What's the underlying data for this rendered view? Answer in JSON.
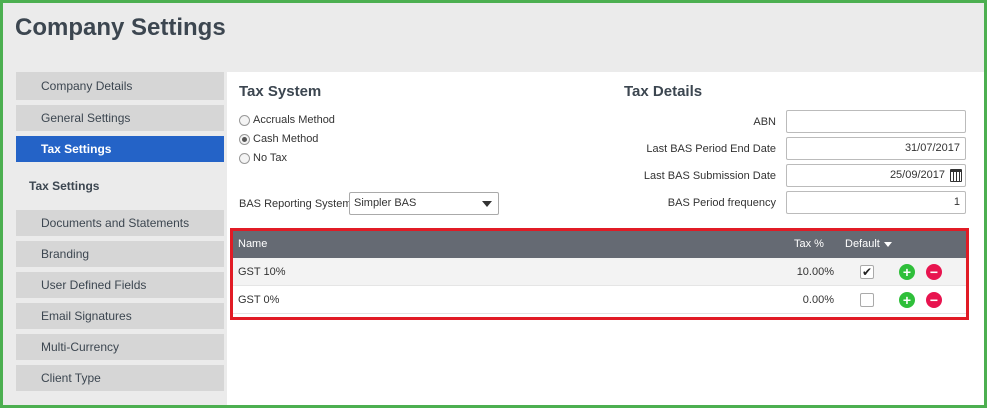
{
  "page_title": "Company Settings",
  "sidebar": {
    "items_top": [
      {
        "label": "Company Details"
      },
      {
        "label": "General Settings"
      },
      {
        "label": "Tax Settings",
        "active": true
      }
    ],
    "section_header": "Tax Settings",
    "items_bottom": [
      {
        "label": "Documents and Statements"
      },
      {
        "label": "Branding"
      },
      {
        "label": "User Defined Fields"
      },
      {
        "label": "Email Signatures"
      },
      {
        "label": "Multi-Currency"
      },
      {
        "label": "Client Type"
      }
    ]
  },
  "tax_system": {
    "title": "Tax System",
    "options": [
      "Accruals Method",
      "Cash Method",
      "No Tax"
    ],
    "selected": "Cash Method",
    "bas_label": "BAS Reporting System",
    "bas_value": "Simpler BAS"
  },
  "tax_details": {
    "title": "Tax Details",
    "abn_label": "ABN",
    "abn_value": "",
    "end_date_label": "Last BAS Period End Date",
    "end_date_value": "31/07/2017",
    "submission_label": "Last BAS Submission Date",
    "submission_value": "25/09/2017",
    "frequency_label": "BAS Period frequency",
    "frequency_value": "1"
  },
  "tax_table": {
    "headers": {
      "name": "Name",
      "tax": "Tax %",
      "default": "Default"
    },
    "rows": [
      {
        "name": "GST 10%",
        "tax": "10.00%",
        "default": true
      },
      {
        "name": "GST 0%",
        "tax": "0.00%",
        "default": false
      }
    ]
  },
  "colors": {
    "active_blue": "#2463c7",
    "header_grey": "#656a73",
    "highlight_red": "#e11b25",
    "frame_green": "#4caf50",
    "add_green": "#2fbf3a",
    "remove_red": "#e8144f"
  }
}
